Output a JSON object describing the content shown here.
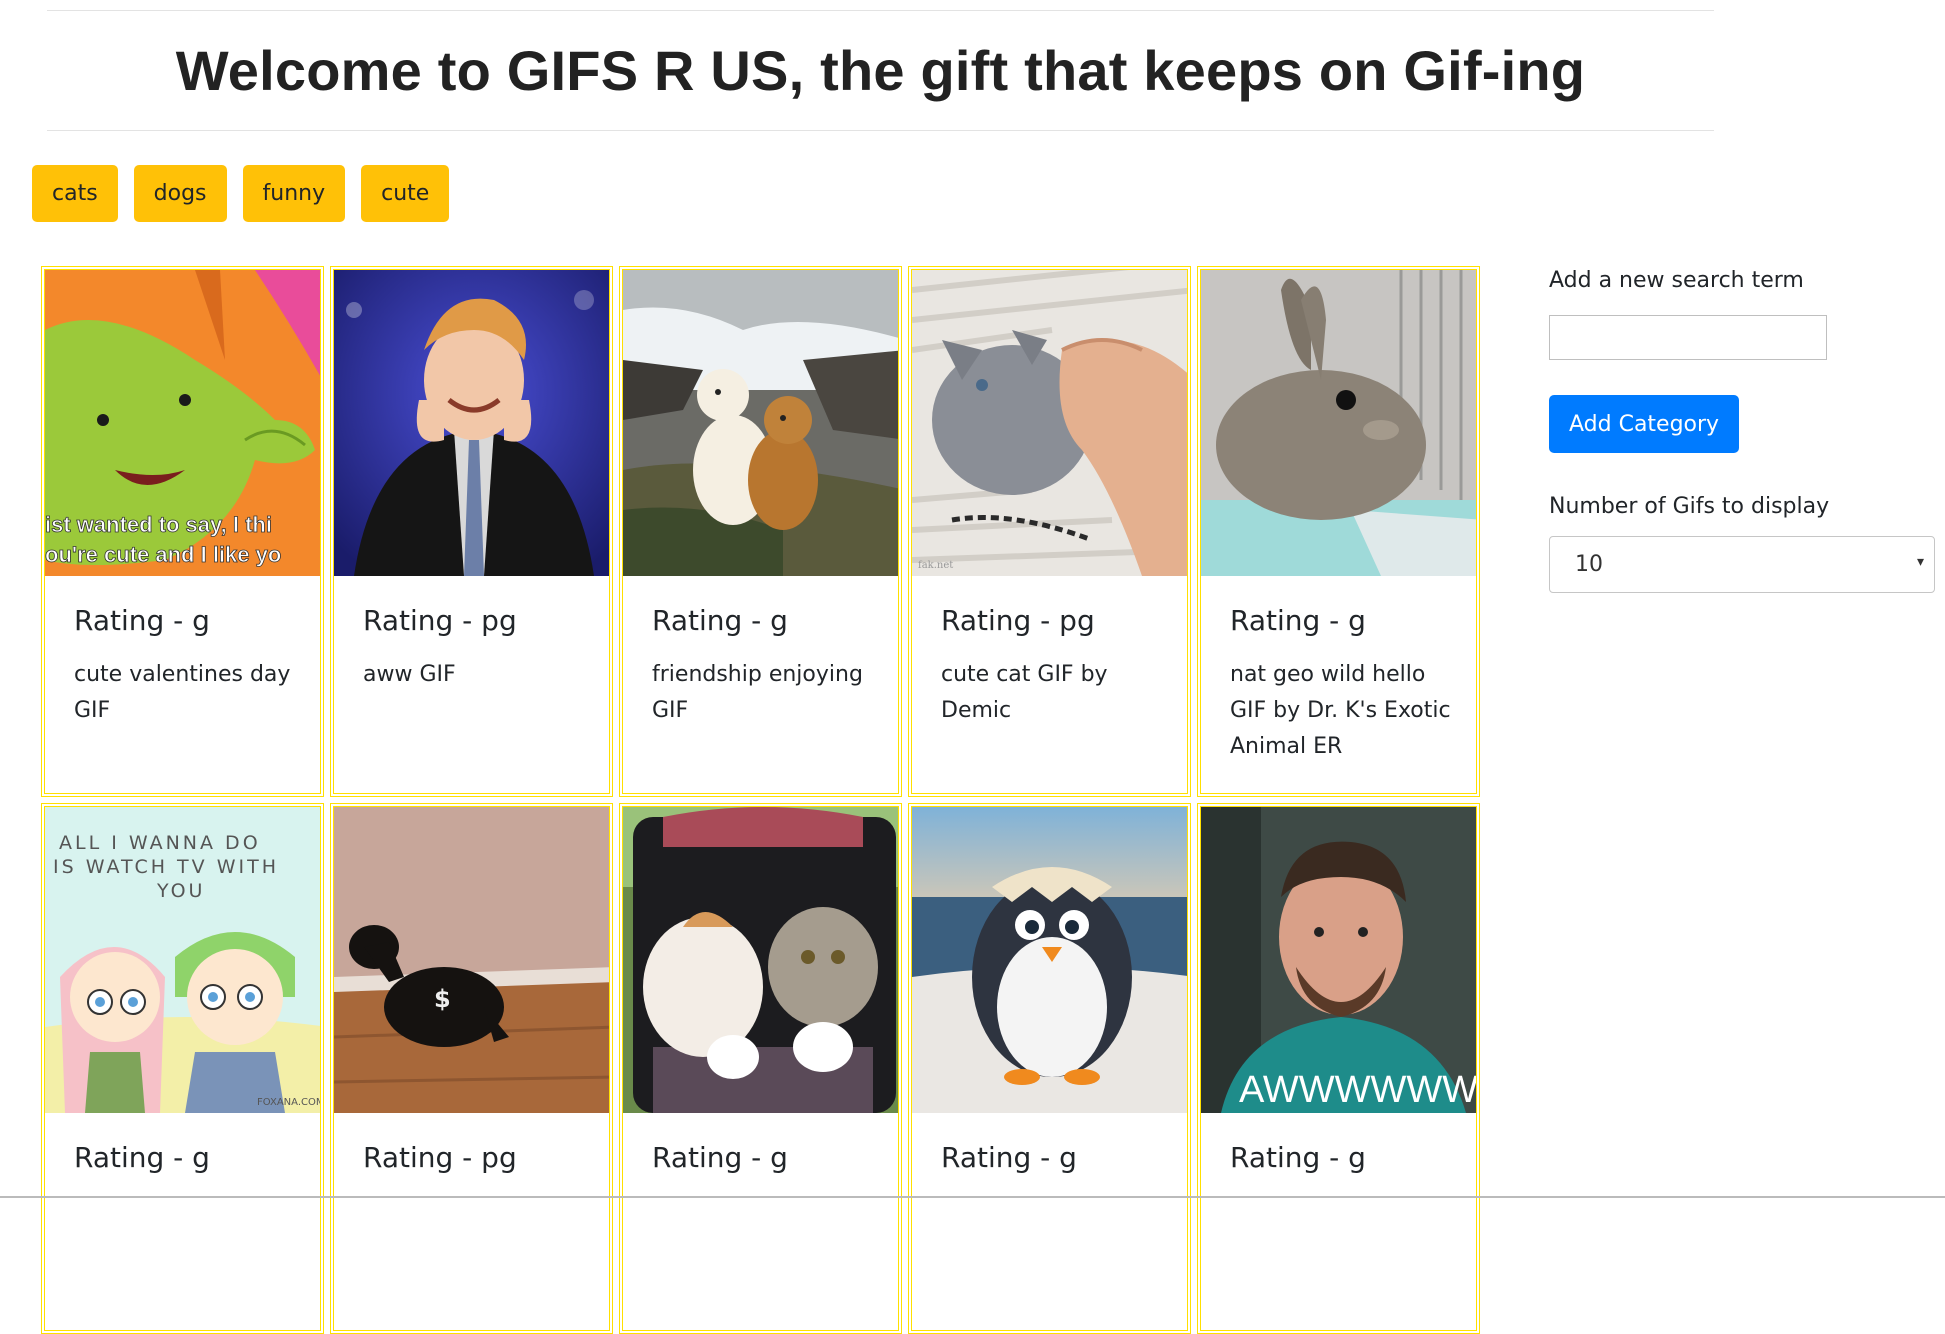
{
  "header": {
    "title": "Welcome to GIFS R US, the gift that keeps on Gif-ing"
  },
  "tags": [
    "cats",
    "dogs",
    "funny",
    "cute"
  ],
  "colors": {
    "tag_bg": "#ffc107",
    "card_border": "#ffe000",
    "primary": "#007bff"
  },
  "cards": [
    {
      "rating": "Rating - g",
      "caption": "cute valentines day GIF",
      "image": "green-elephant-cartoon",
      "overlay": "ist wanted to say, I thi\nou're cute and I like yo"
    },
    {
      "rating": "Rating - pg",
      "caption": "aww GIF",
      "image": "man-blushing"
    },
    {
      "rating": "Rating - g",
      "caption": "friendship enjoying GIF",
      "image": "dogs-waterfall"
    },
    {
      "rating": "Rating - pg",
      "caption": "cute cat GIF by Demic",
      "image": "kitten-hand"
    },
    {
      "rating": "Rating - g",
      "caption": "nat geo wild hello GIF by Dr. K's Exotic Animal ER",
      "image": "bunny"
    },
    {
      "rating": "Rating - g",
      "caption": "",
      "image": "couple-cartoon",
      "overlay": "ALL I WANNA DO\nIS WATCH TV WITH\nYOU"
    },
    {
      "rating": "Rating - pg",
      "caption": "",
      "image": "dachshund"
    },
    {
      "rating": "Rating - g",
      "caption": "",
      "image": "cats-stroller"
    },
    {
      "rating": "Rating - g",
      "caption": "",
      "image": "baby-penguin"
    },
    {
      "rating": "Rating - g",
      "caption": "",
      "image": "man-teal-shirt",
      "overlay": "AWWWWWW"
    }
  ],
  "sidebar": {
    "search_label": "Add a new search term",
    "search_value": "",
    "add_button": "Add Category",
    "count_label": "Number of Gifs to display",
    "count_value": "10"
  }
}
